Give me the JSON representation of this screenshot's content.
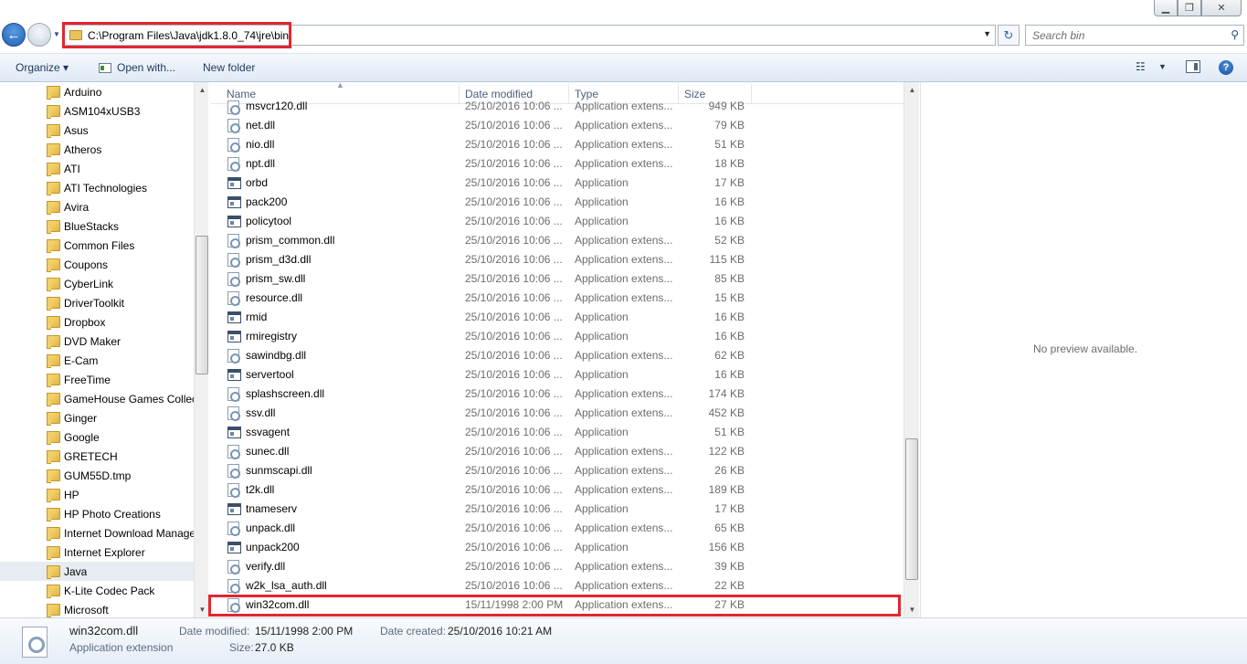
{
  "window": {
    "minimize_glyph": "▁",
    "maximize_glyph": "❐",
    "close_glyph": "✕"
  },
  "address_bar": {
    "path": "C:\\Program Files\\Java\\jdk1.8.0_74\\jre\\bin",
    "search_placeholder": "Search bin"
  },
  "toolbar": {
    "organize": "Organize ▾",
    "open_with": "Open with...",
    "new_folder": "New folder"
  },
  "sidebar": {
    "items": [
      {
        "label": "Arduino"
      },
      {
        "label": "ASM104xUSB3"
      },
      {
        "label": "Asus"
      },
      {
        "label": "Atheros"
      },
      {
        "label": "ATI"
      },
      {
        "label": "ATI Technologies"
      },
      {
        "label": "Avira"
      },
      {
        "label": "BlueStacks"
      },
      {
        "label": "Common Files"
      },
      {
        "label": "Coupons"
      },
      {
        "label": "CyberLink"
      },
      {
        "label": "DriverToolkit"
      },
      {
        "label": "Dropbox"
      },
      {
        "label": "DVD Maker"
      },
      {
        "label": "E-Cam"
      },
      {
        "label": "FreeTime"
      },
      {
        "label": "GameHouse Games Collection"
      },
      {
        "label": "Ginger"
      },
      {
        "label": "Google"
      },
      {
        "label": "GRETECH"
      },
      {
        "label": "GUM55D.tmp"
      },
      {
        "label": "HP"
      },
      {
        "label": "HP Photo Creations"
      },
      {
        "label": "Internet Download Manager"
      },
      {
        "label": "Internet Explorer"
      },
      {
        "label": "Java",
        "selected": true
      },
      {
        "label": "K-Lite Codec Pack"
      },
      {
        "label": "Microsoft"
      }
    ]
  },
  "columns": {
    "name": "Name",
    "date_modified": "Date modified",
    "type": "Type",
    "size": "Size"
  },
  "files": [
    {
      "name": "msvcr120.dll",
      "date": "25/10/2016 10:06 ...",
      "type": "Application extens...",
      "size": "949 KB",
      "kind": "dll"
    },
    {
      "name": "net.dll",
      "date": "25/10/2016 10:06 ...",
      "type": "Application extens...",
      "size": "79 KB",
      "kind": "dll"
    },
    {
      "name": "nio.dll",
      "date": "25/10/2016 10:06 ...",
      "type": "Application extens...",
      "size": "51 KB",
      "kind": "dll"
    },
    {
      "name": "npt.dll",
      "date": "25/10/2016 10:06 ...",
      "type": "Application extens...",
      "size": "18 KB",
      "kind": "dll"
    },
    {
      "name": "orbd",
      "date": "25/10/2016 10:06 ...",
      "type": "Application",
      "size": "17 KB",
      "kind": "app"
    },
    {
      "name": "pack200",
      "date": "25/10/2016 10:06 ...",
      "type": "Application",
      "size": "16 KB",
      "kind": "app"
    },
    {
      "name": "policytool",
      "date": "25/10/2016 10:06 ...",
      "type": "Application",
      "size": "16 KB",
      "kind": "app"
    },
    {
      "name": "prism_common.dll",
      "date": "25/10/2016 10:06 ...",
      "type": "Application extens...",
      "size": "52 KB",
      "kind": "dll"
    },
    {
      "name": "prism_d3d.dll",
      "date": "25/10/2016 10:06 ...",
      "type": "Application extens...",
      "size": "115 KB",
      "kind": "dll"
    },
    {
      "name": "prism_sw.dll",
      "date": "25/10/2016 10:06 ...",
      "type": "Application extens...",
      "size": "85 KB",
      "kind": "dll"
    },
    {
      "name": "resource.dll",
      "date": "25/10/2016 10:06 ...",
      "type": "Application extens...",
      "size": "15 KB",
      "kind": "dll"
    },
    {
      "name": "rmid",
      "date": "25/10/2016 10:06 ...",
      "type": "Application",
      "size": "16 KB",
      "kind": "app"
    },
    {
      "name": "rmiregistry",
      "date": "25/10/2016 10:06 ...",
      "type": "Application",
      "size": "16 KB",
      "kind": "app"
    },
    {
      "name": "sawindbg.dll",
      "date": "25/10/2016 10:06 ...",
      "type": "Application extens...",
      "size": "62 KB",
      "kind": "dll"
    },
    {
      "name": "servertool",
      "date": "25/10/2016 10:06 ...",
      "type": "Application",
      "size": "16 KB",
      "kind": "app"
    },
    {
      "name": "splashscreen.dll",
      "date": "25/10/2016 10:06 ...",
      "type": "Application extens...",
      "size": "174 KB",
      "kind": "dll"
    },
    {
      "name": "ssv.dll",
      "date": "25/10/2016 10:06 ...",
      "type": "Application extens...",
      "size": "452 KB",
      "kind": "dll"
    },
    {
      "name": "ssvagent",
      "date": "25/10/2016 10:06 ...",
      "type": "Application",
      "size": "51 KB",
      "kind": "app"
    },
    {
      "name": "sunec.dll",
      "date": "25/10/2016 10:06 ...",
      "type": "Application extens...",
      "size": "122 KB",
      "kind": "dll"
    },
    {
      "name": "sunmscapi.dll",
      "date": "25/10/2016 10:06 ...",
      "type": "Application extens...",
      "size": "26 KB",
      "kind": "dll"
    },
    {
      "name": "t2k.dll",
      "date": "25/10/2016 10:06 ...",
      "type": "Application extens...",
      "size": "189 KB",
      "kind": "dll"
    },
    {
      "name": "tnameserv",
      "date": "25/10/2016 10:06 ...",
      "type": "Application",
      "size": "17 KB",
      "kind": "app"
    },
    {
      "name": "unpack.dll",
      "date": "25/10/2016 10:06 ...",
      "type": "Application extens...",
      "size": "65 KB",
      "kind": "dll"
    },
    {
      "name": "unpack200",
      "date": "25/10/2016 10:06 ...",
      "type": "Application",
      "size": "156 KB",
      "kind": "app"
    },
    {
      "name": "verify.dll",
      "date": "25/10/2016 10:06 ...",
      "type": "Application extens...",
      "size": "39 KB",
      "kind": "dll"
    },
    {
      "name": "w2k_lsa_auth.dll",
      "date": "25/10/2016 10:06 ...",
      "type": "Application extens...",
      "size": "22 KB",
      "kind": "dll"
    },
    {
      "name": "win32com.dll",
      "date": "15/11/1998 2:00 PM",
      "type": "Application extens...",
      "size": "27 KB",
      "kind": "dll",
      "highlighted": true
    }
  ],
  "preview": {
    "message": "No preview available."
  },
  "details": {
    "file_name": "win32com.dll",
    "file_type": "Application extension",
    "date_modified_label": "Date modified:",
    "date_modified_value": "15/11/1998 2:00 PM",
    "date_created_label": "Date created:",
    "date_created_value": "25/10/2016 10:21 AM",
    "size_label": "Size:",
    "size_value": "27.0 KB"
  },
  "colors": {
    "highlight_border": "#e3262e",
    "toolbar_text": "#1e395b",
    "secondary_text": "#6d6d6d"
  }
}
